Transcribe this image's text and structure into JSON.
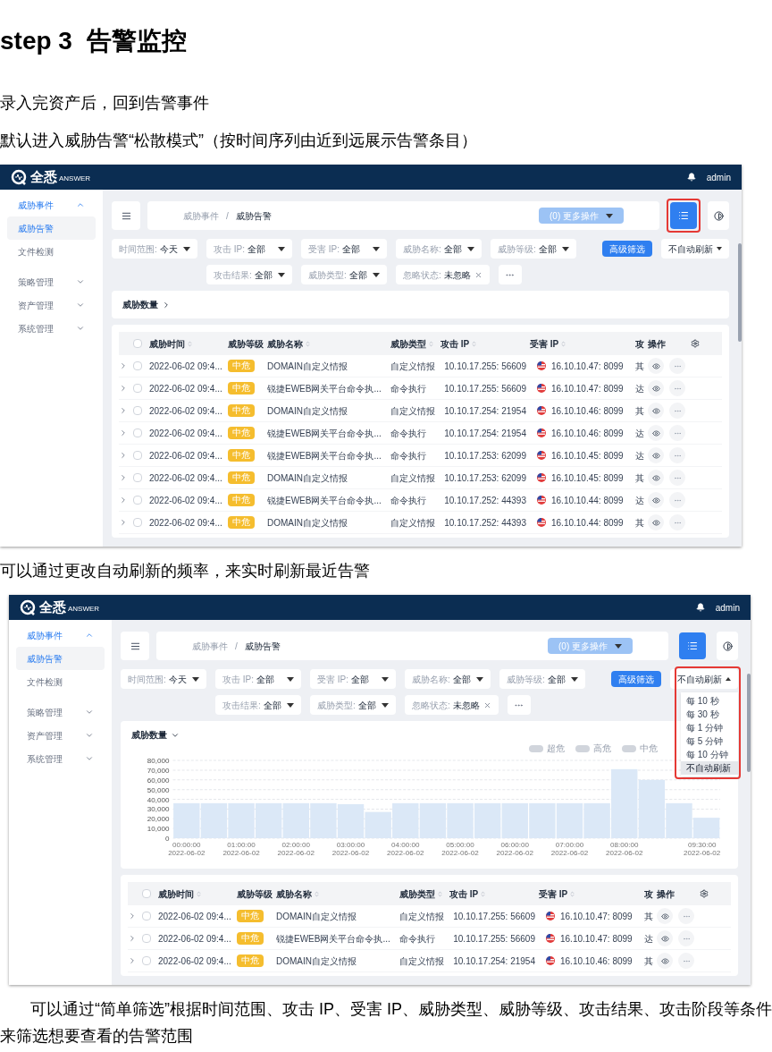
{
  "title": {
    "step": "step 3",
    "text": "告警监控"
  },
  "blocks": [
    {
      "kind": "text",
      "indent": false,
      "text": "录入完资产后，回到告警事件"
    },
    {
      "kind": "text",
      "indent": false,
      "text": "默认进入威胁告警“松散模式”（按时间序列由近到远展示告警条目）"
    },
    {
      "kind": "screen",
      "header": {
        "logo": "全悉",
        "logo_sub": "ANSWER",
        "user": "admin"
      },
      "sidebar": [
        {
          "label": "威胁事件",
          "expanded": true,
          "children": [
            {
              "label": "威胁告警",
              "selected": true
            },
            {
              "label": "文件检测",
              "selected": false
            }
          ]
        },
        {
          "label": "策略管理",
          "expanded": false
        },
        {
          "label": "资产管理",
          "expanded": false
        },
        {
          "label": "系统管理",
          "expanded": false
        }
      ],
      "breadcrumb": [
        "威胁事件",
        "威胁告警"
      ],
      "breadcrumb_separator": "/",
      "more_button": "(0) 更多操作",
      "view_toggle": {
        "highlighted": true
      },
      "filters": [
        {
          "kind": "select",
          "label": "时间范围:",
          "value": "今天"
        },
        {
          "kind": "select",
          "label": "攻击 IP:",
          "value": "全部"
        },
        {
          "kind": "select",
          "label": "受害 IP:",
          "value": "全部"
        },
        {
          "kind": "select",
          "label": "威胁名称:",
          "value": "全部"
        },
        {
          "kind": "select",
          "label": "威胁等级:",
          "value": "全部"
        }
      ],
      "filters_row2": [
        {
          "kind": "select",
          "label": "攻击结果:",
          "value": "全部"
        },
        {
          "kind": "select",
          "label": "威胁类型:",
          "value": "全部"
        },
        {
          "kind": "tag",
          "label": "忽略状态:",
          "value": "未忽略"
        },
        {
          "kind": "more"
        }
      ],
      "advanced_button": "高级筛选",
      "refresh": {
        "value": "不自动刷新",
        "expanded": false,
        "highlighted": false
      },
      "summary": {
        "title": "威胁数量",
        "expanded": false
      },
      "table": {
        "columns": [
          "威胁时间",
          "威胁等级",
          "威胁名称",
          "威胁类型",
          "攻击 IP",
          "受害 IP",
          "攻",
          "操作"
        ],
        "all_checked": false,
        "rows": [
          {
            "checked": false,
            "time": "2022-06-02 09:4...",
            "level": "中危",
            "name": "DOMAIN自定义情报",
            "type": "自定义情报",
            "attack_ip": "10.10.17.255: 56609",
            "victim_ip": "16.10.10.47: 8099",
            "result": "其"
          },
          {
            "checked": false,
            "time": "2022-06-02 09:4...",
            "level": "中危",
            "name": "锐捷EWEB网关平台命令执...",
            "type": "命令执行",
            "attack_ip": "10.10.17.255: 56609",
            "victim_ip": "16.10.10.47: 8099",
            "result": "达"
          },
          {
            "checked": false,
            "time": "2022-06-02 09:4...",
            "level": "中危",
            "name": "DOMAIN自定义情报",
            "type": "自定义情报",
            "attack_ip": "10.10.17.254: 21954",
            "victim_ip": "16.10.10.46: 8099",
            "result": "其"
          },
          {
            "checked": false,
            "time": "2022-06-02 09:4...",
            "level": "中危",
            "name": "锐捷EWEB网关平台命令执...",
            "type": "命令执行",
            "attack_ip": "10.10.17.254: 21954",
            "victim_ip": "16.10.10.46: 8099",
            "result": "达"
          },
          {
            "checked": false,
            "time": "2022-06-02 09:4...",
            "level": "中危",
            "name": "锐捷EWEB网关平台命令执...",
            "type": "命令执行",
            "attack_ip": "10.10.17.253: 62099",
            "victim_ip": "16.10.10.45: 8099",
            "result": "达"
          },
          {
            "checked": false,
            "time": "2022-06-02 09:4...",
            "level": "中危",
            "name": "DOMAIN自定义情报",
            "type": "自定义情报",
            "attack_ip": "10.10.17.253: 62099",
            "victim_ip": "16.10.10.45: 8099",
            "result": "其"
          },
          {
            "checked": false,
            "time": "2022-06-02 09:4...",
            "level": "中危",
            "name": "锐捷EWEB网关平台命令执...",
            "type": "命令执行",
            "attack_ip": "10.10.17.252: 44393",
            "victim_ip": "16.10.10.44: 8099",
            "result": "达"
          },
          {
            "checked": false,
            "time": "2022-06-02 09:4...",
            "level": "中危",
            "name": "DOMAIN自定义情报",
            "type": "自定义情报",
            "attack_ip": "10.10.17.252: 44393",
            "victim_ip": "16.10.10.44: 8099",
            "result": "其"
          }
        ]
      }
    },
    {
      "kind": "text",
      "indent": false,
      "text": "可以通过更改自动刷新的频率，来实时刷新最近告警"
    },
    {
      "kind": "screen",
      "header": {
        "logo": "全悉",
        "logo_sub": "ANSWER",
        "user": "admin"
      },
      "sidebar": [
        {
          "label": "威胁事件",
          "expanded": true,
          "children": [
            {
              "label": "威胁告警",
              "selected": true
            },
            {
              "label": "文件检测",
              "selected": false
            }
          ]
        },
        {
          "label": "策略管理",
          "expanded": false
        },
        {
          "label": "资产管理",
          "expanded": false
        },
        {
          "label": "系统管理",
          "expanded": false
        }
      ],
      "breadcrumb": [
        "威胁事件",
        "威胁告警"
      ],
      "breadcrumb_separator": "/",
      "more_button": "(0) 更多操作",
      "view_toggle": {
        "highlighted": false
      },
      "filters": [
        {
          "kind": "select",
          "label": "时间范围:",
          "value": "今天"
        },
        {
          "kind": "select",
          "label": "攻击 IP:",
          "value": "全部"
        },
        {
          "kind": "select",
          "label": "受害 IP:",
          "value": "全部"
        },
        {
          "kind": "select",
          "label": "威胁名称:",
          "value": "全部"
        },
        {
          "kind": "select",
          "label": "威胁等级:",
          "value": "全部"
        }
      ],
      "filters_row2": [
        {
          "kind": "select",
          "label": "攻击结果:",
          "value": "全部"
        },
        {
          "kind": "select",
          "label": "威胁类型:",
          "value": "全部"
        },
        {
          "kind": "tag",
          "label": "忽略状态:",
          "value": "未忽略"
        },
        {
          "kind": "more"
        }
      ],
      "advanced_button": "高级筛选",
      "refresh": {
        "value": "不自动刷新",
        "expanded": true,
        "highlighted": true,
        "options": [
          {
            "label": "每 10 秒",
            "selected": false
          },
          {
            "label": "每 30 秒",
            "selected": false
          },
          {
            "label": "每 1 分钟",
            "selected": false
          },
          {
            "label": "每 5 分钟",
            "selected": false
          },
          {
            "label": "每 10 分钟",
            "selected": false
          },
          {
            "label": "不自动刷新",
            "selected": true
          }
        ]
      },
      "summary": {
        "title": "威胁数量",
        "expanded": true,
        "legend": [
          "超危",
          "高危",
          "中危"
        ],
        "chart_data": {
          "type": "bar",
          "grid": true,
          "categories": [
            "00:00:00 2022-06-02",
            null,
            "01:00:00 2022-06-02",
            null,
            "02:00:00 2022-06-02",
            null,
            "03:00:00 2022-06-02",
            null,
            "04:00:00 2022-06-02",
            null,
            "05:00:00 2022-06-02",
            null,
            "06:00:00 2022-06-02",
            null,
            "07:00:00 2022-06-02",
            null,
            "08:00:00 2022-06-02",
            null,
            null,
            "09:30:00 2022-06-02"
          ],
          "values": [
            36000,
            36000,
            36000,
            36000,
            36000,
            36000,
            35000,
            27000,
            36000,
            36000,
            36000,
            36000,
            36000,
            36000,
            36000,
            36000,
            71000,
            60000,
            36000,
            21000
          ],
          "ylim": [
            0,
            80000
          ],
          "yticks": [
            {
              "value": 0,
              "label": "0"
            },
            {
              "value": 10000,
              "label": "10,000"
            },
            {
              "value": 20000,
              "label": "20,000"
            },
            {
              "value": 30000,
              "label": "30,000"
            },
            {
              "value": 40000,
              "label": "40,000"
            },
            {
              "value": 50000,
              "label": "50,000"
            },
            {
              "value": 60000,
              "label": "60,000"
            },
            {
              "value": 70000,
              "label": "70,000"
            },
            {
              "value": 80000,
              "label": "80,000"
            }
          ]
        }
      },
      "table": {
        "columns": [
          "威胁时间",
          "威胁等级",
          "威胁名称",
          "威胁类型",
          "攻击 IP",
          "受害 IP",
          "攻",
          "操作"
        ],
        "all_checked": false,
        "rows": [
          {
            "checked": false,
            "time": "2022-06-02 09:4...",
            "level": "中危",
            "name": "DOMAIN自定义情报",
            "type": "自定义情报",
            "attack_ip": "10.10.17.255: 56609",
            "victim_ip": "16.10.10.47: 8099",
            "result": "其"
          },
          {
            "checked": false,
            "time": "2022-06-02 09:4...",
            "level": "中危",
            "name": "锐捷EWEB网关平台命令执...",
            "type": "命令执行",
            "attack_ip": "10.10.17.255: 56609",
            "victim_ip": "16.10.10.47: 8099",
            "result": "达"
          },
          {
            "checked": false,
            "time": "2022-06-02 09:4...",
            "level": "中危",
            "name": "DOMAIN自定义情报",
            "type": "自定义情报",
            "attack_ip": "10.10.17.254: 21954",
            "victim_ip": "16.10.10.46: 8099",
            "result": "其"
          }
        ]
      }
    },
    {
      "kind": "text",
      "indent": true,
      "text": "可以通过“简单筛选”根据时间范围、攻击 IP、受害 IP、威胁类型、威胁等级、攻击结果、攻击阶段等条件来筛选想要查看的告警范围"
    }
  ]
}
